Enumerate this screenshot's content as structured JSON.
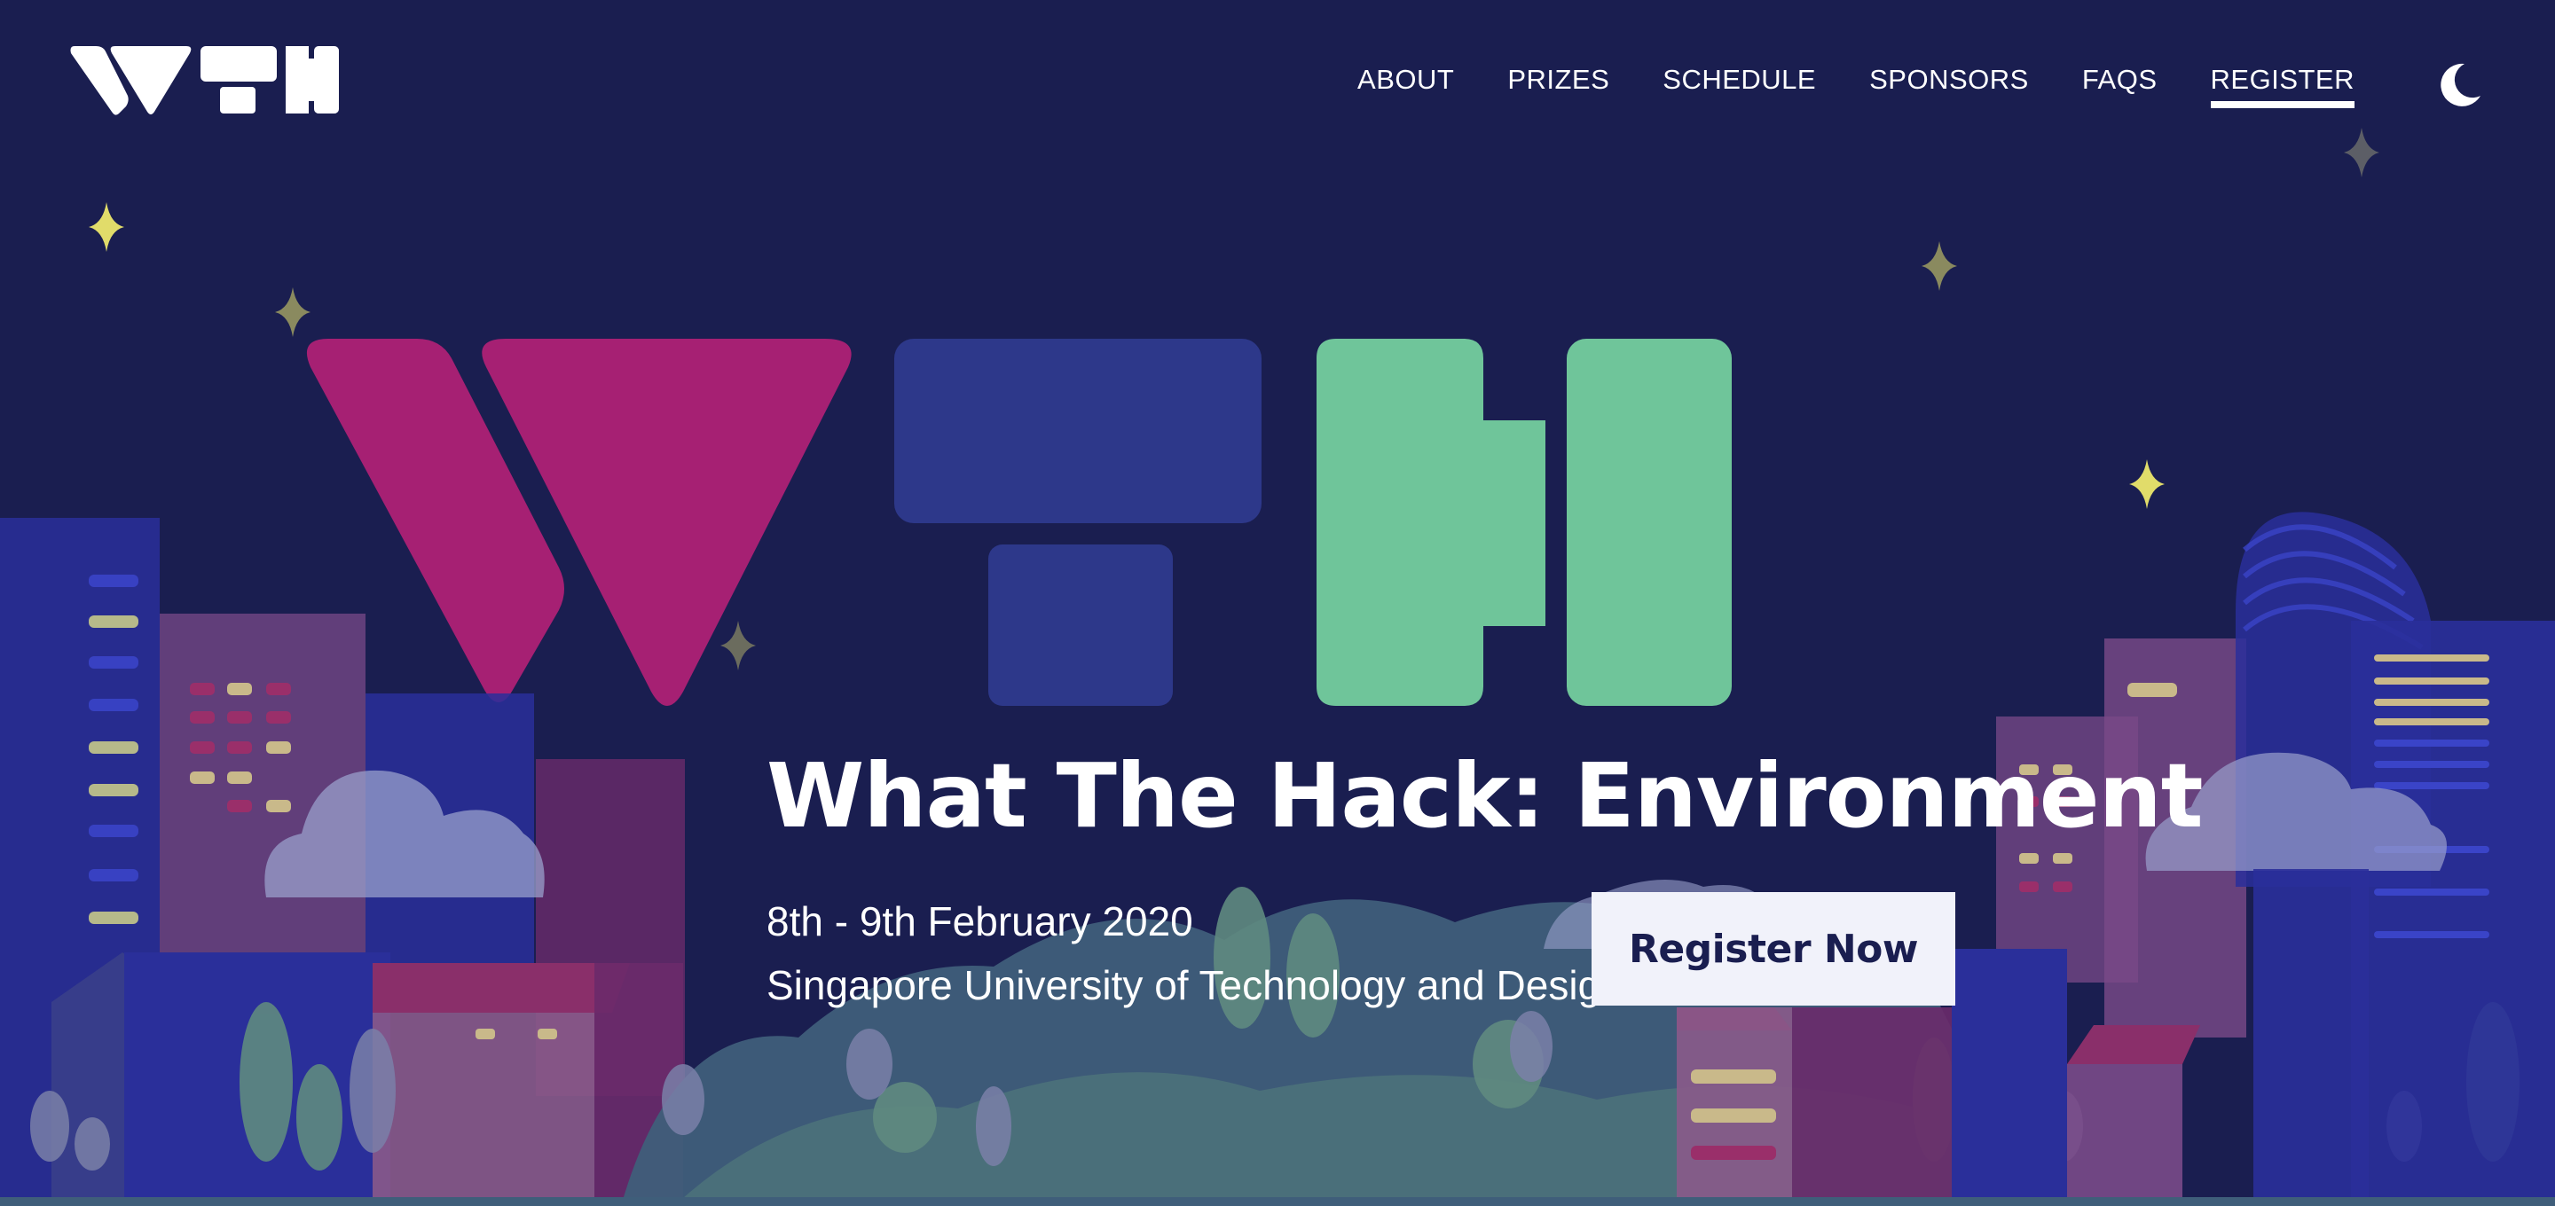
{
  "brand": {
    "logo_text": "WTH"
  },
  "nav": {
    "items": [
      {
        "label": "ABOUT"
      },
      {
        "label": "PRIZES"
      },
      {
        "label": "SCHEDULE"
      },
      {
        "label": "SPONSORS"
      },
      {
        "label": "FAQS"
      },
      {
        "label": "REGISTER"
      }
    ],
    "active": "REGISTER",
    "theme_icon": "moon-icon"
  },
  "hero": {
    "title": "What The Hack: Environment",
    "date": "8th - 9th February 2020",
    "venue": "Singapore University of Technology and Design",
    "cta_label": "Register Now"
  },
  "colors": {
    "background": "#1a1e50",
    "logo_w": "#a62073",
    "logo_t": "#2d388a",
    "logo_h": "#6fc59a",
    "star_yellow": "#e1dc6a",
    "star_grey": "#6b6c5e",
    "button_bg": "#f1f2fa",
    "button_text": "#1a1e50"
  }
}
